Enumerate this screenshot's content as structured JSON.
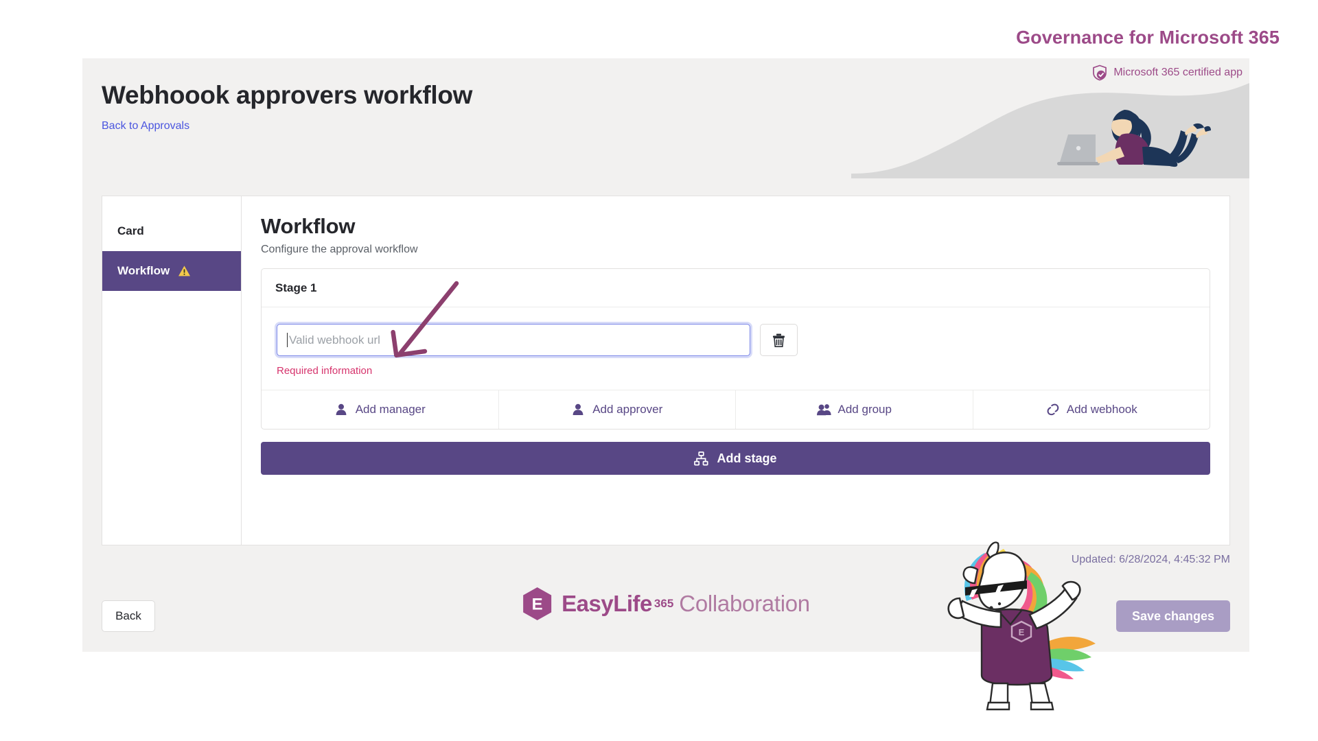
{
  "brand": {
    "product_title": "Governance for Microsoft 365",
    "certified_label": "Microsoft 365 certified app",
    "shield_icon": "shield-check-icon",
    "accent_purple": "#584785",
    "accent_magenta": "#9c4a88",
    "link_blue": "#4a55df",
    "error_red": "#d6336c"
  },
  "banner": {
    "page_title": "Webhoook approvers workflow",
    "back_link": "Back to Approvals",
    "illustration": "woman-with-laptop-illustration"
  },
  "side_nav": {
    "items": [
      {
        "label": "Card",
        "active": false,
        "icon": ""
      },
      {
        "label": "Workflow",
        "active": true,
        "icon": "warning-triangle-icon"
      }
    ]
  },
  "main": {
    "title": "Workflow",
    "subtitle": "Configure the approval workflow",
    "stage": {
      "header": "Stage 1",
      "webhook_field": {
        "value": "",
        "placeholder": "Valid webhook url",
        "focused": true,
        "error": "Required information"
      },
      "delete_icon": "trash-icon",
      "actions": [
        {
          "label": "Add manager",
          "icon": "person-icon"
        },
        {
          "label": "Add approver",
          "icon": "person-icon"
        },
        {
          "label": "Add group",
          "icon": "people-icon"
        },
        {
          "label": "Add webhook",
          "icon": "link-icon"
        }
      ]
    },
    "add_stage": {
      "label": "Add stage",
      "icon": "hierarchy-icon"
    }
  },
  "footer": {
    "updated_text": "Updated: 6/28/2024, 4:45:32 PM",
    "back_label": "Back",
    "save_label": "Save changes",
    "save_disabled": true,
    "logo": {
      "mark_letter": "E",
      "name": "EasyLife",
      "suffix": "365",
      "product": "Collaboration"
    },
    "mascot": "dabbing-unicorn-mascot"
  },
  "annotation": {
    "arrow": "arrow-pointing-to-webhook-input",
    "color": "#8c3f6e"
  }
}
